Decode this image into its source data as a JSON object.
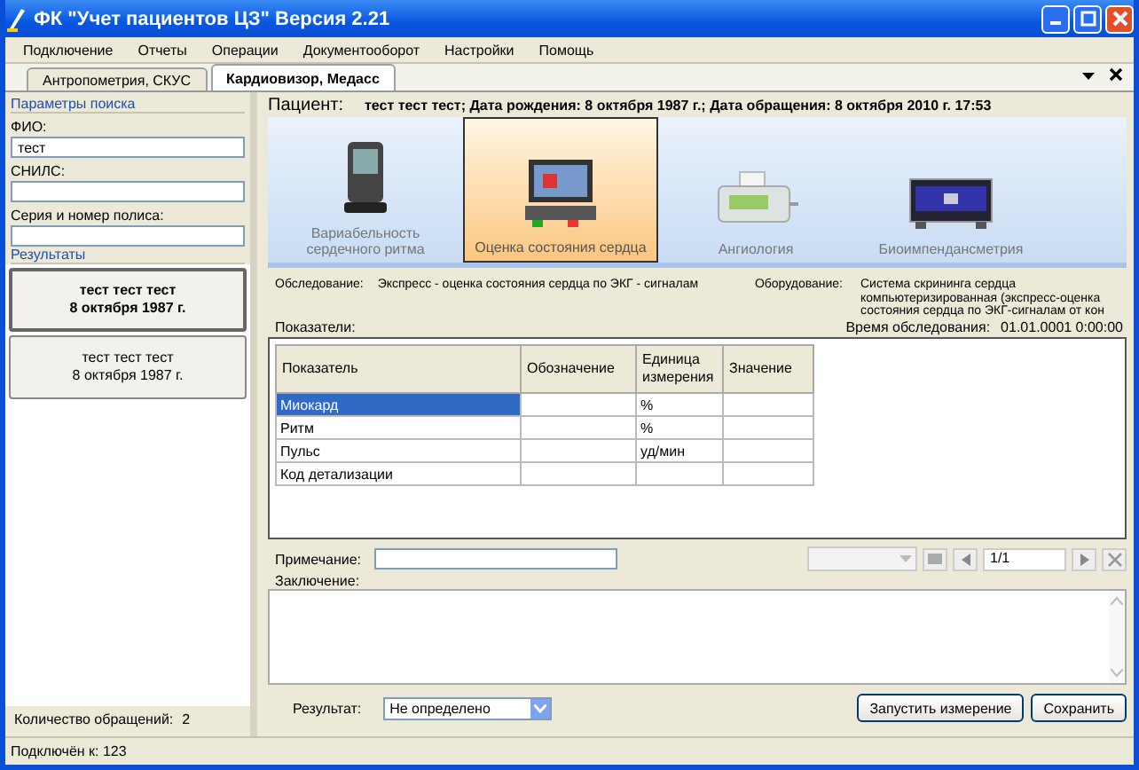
{
  "window": {
    "title": "ФК \"Учет пациентов ЦЗ\" Версия 2.21"
  },
  "menu": [
    "Подключение",
    "Отчеты",
    "Операции",
    "Документооборот",
    "Настройки",
    "Помощь"
  ],
  "tabs": [
    {
      "label": "Антропометрия, СКУС",
      "selected": false
    },
    {
      "label": "Кардиовизор, Медасс",
      "selected": true
    }
  ],
  "search": {
    "title": "Параметры поиска",
    "fields": [
      {
        "label": "ФИО:",
        "value": "тест"
      },
      {
        "label": "СНИЛС:"
      },
      {
        "label": "Серия и номер полиса:"
      }
    ]
  },
  "results": {
    "title": "Результаты",
    "items": [
      {
        "name": "тест тест тест",
        "date": "8 октября 1987 г.",
        "selected": true
      },
      {
        "name": "тест тест тест",
        "date": "8 октября 1987 г.",
        "selected": false
      }
    ]
  },
  "visits": {
    "label": "Количество обращений:",
    "value": "2"
  },
  "patient": {
    "label": "Пациент:",
    "text": "тест тест тест; Дата рождения: 8 октября 1987 г.; Дата обращения: 8 октября 2010 г. 17:53"
  },
  "devices": [
    {
      "label": "Вариабельность сердечного ритма",
      "selected": false
    },
    {
      "label": "Оценка состояния сердца",
      "selected": true
    },
    {
      "label": "Ангиология",
      "selected": false
    },
    {
      "label": "Биоимпендансметрия",
      "selected": false
    }
  ],
  "exam": {
    "label": "Обследование:",
    "value": "Экспресс - оценка состояния сердца по ЭКГ - сигналам"
  },
  "equipment": {
    "label": "Оборудование:",
    "value": "Система скрининга сердца компьютеризированная (экспресс-оценка состояния сердца по ЭКГ-сигналам от кон"
  },
  "exam_time": {
    "label": "Время обследования:",
    "value": "01.01.0001 0:00:00"
  },
  "indicators": {
    "label": "Показатели:",
    "columns": [
      "Показатель",
      "Обозначение",
      "Единица измерения",
      "Значение"
    ],
    "rows": [
      {
        "name": "Миокард",
        "unit": "%",
        "selected": true
      },
      {
        "name": "Ритм",
        "unit": "%",
        "selected": false
      },
      {
        "name": "Пульс",
        "unit": "уд/мин",
        "selected": false
      },
      {
        "name": "Код детализации",
        "selected": false
      }
    ]
  },
  "note": {
    "label": "Примечание:"
  },
  "pager": {
    "value": "1/1"
  },
  "conclusion": {
    "label": "Заключение:"
  },
  "result": {
    "label": "Результат:",
    "value": "Не определено"
  },
  "buttons": [
    "Запустить измерение",
    "Сохранить"
  ],
  "status_bar": "Подключён к: 123"
}
